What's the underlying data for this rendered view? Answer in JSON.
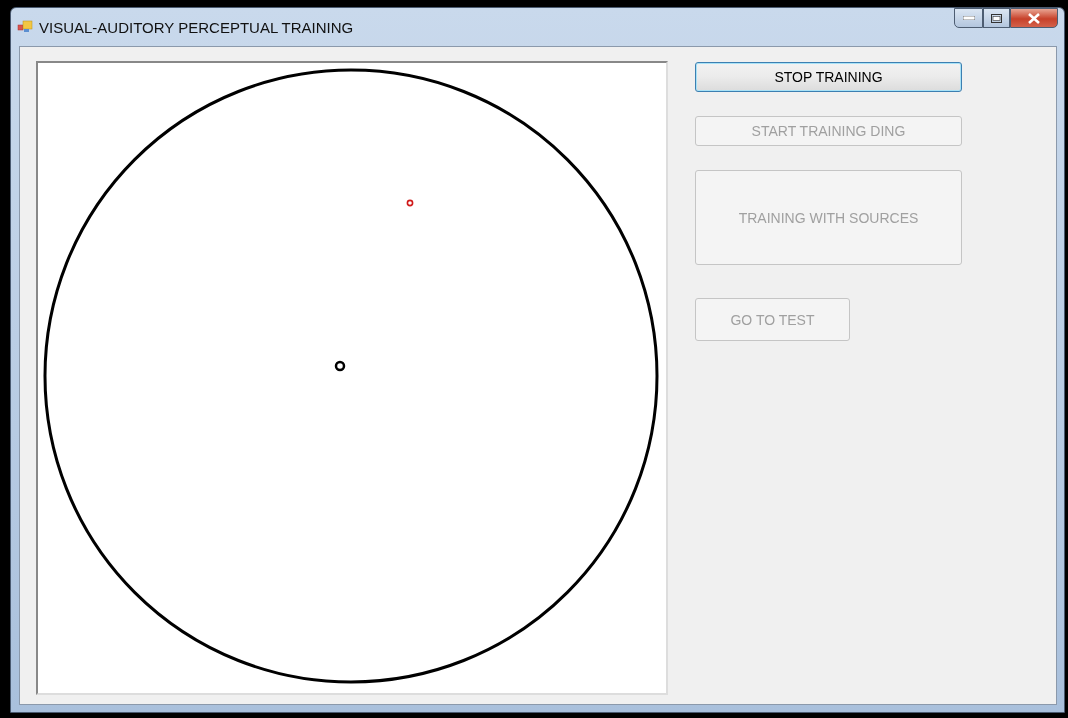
{
  "window": {
    "title": "VISUAL-AUDITORY PERCEPTUAL TRAINING"
  },
  "buttons": [
    {
      "label": "STOP TRAINING",
      "kind": "wide",
      "disabled": false,
      "focused": true
    },
    {
      "label": "START TRAINING DING",
      "kind": "wide",
      "disabled": true,
      "focused": false
    },
    {
      "label": "TRAINING WITH SOURCES",
      "kind": "tall",
      "disabled": true,
      "focused": false
    },
    {
      "label": "GO TO TEST",
      "kind": "small",
      "disabled": true,
      "focused": false
    }
  ]
}
